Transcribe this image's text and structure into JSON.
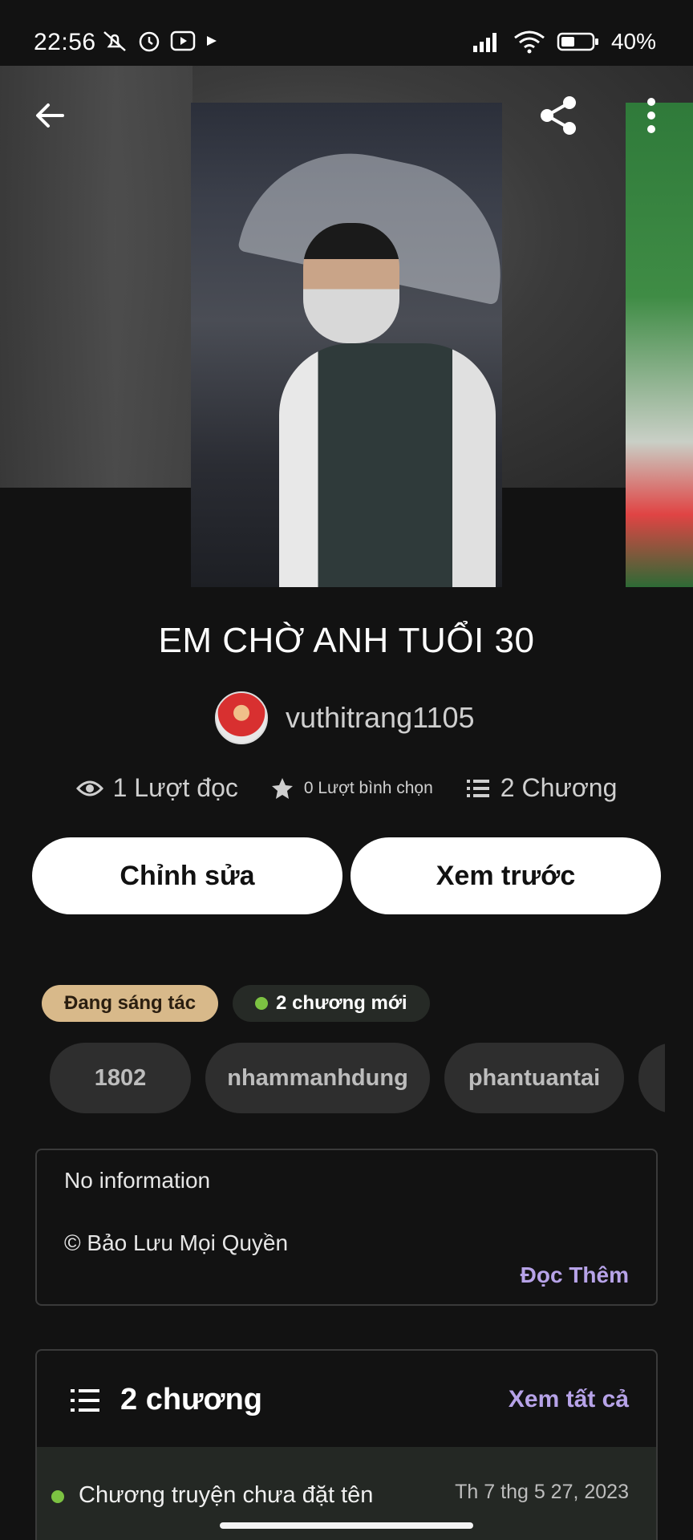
{
  "status_bar": {
    "time": "22:56",
    "battery_text": "40%",
    "icons_left": [
      "mute-icon",
      "alarm-icon",
      "youtube-icon",
      "play-icon"
    ],
    "icons_right": [
      "signal-icon",
      "wifi-icon",
      "battery-icon"
    ]
  },
  "header": {
    "back_icon": "arrow-left-icon",
    "share_icon": "share-icon",
    "more_icon": "more-vertical-icon"
  },
  "story": {
    "title": "EM CHỜ ANH TUỔI 30",
    "author": "vuthitrang1105"
  },
  "stats": {
    "reads": "1 Lượt đọc",
    "votes": "0 Lượt bình chọn",
    "chapters": "2 Chương"
  },
  "actions": {
    "edit_label": "Chỉnh sửa",
    "preview_label": "Xem trước"
  },
  "badges": {
    "status": "Đang sáng tác",
    "new_chapters": "2 chương mới"
  },
  "tags": [
    "1802",
    "nhammanhdung",
    "phantuantai",
    ""
  ],
  "description": {
    "line1": "No information",
    "line2": "© Bảo Lưu Mọi Quyền",
    "read_more": "Đọc Thêm"
  },
  "chapter_list": {
    "count_label": "2 chương",
    "see_all": "Xem tất cả",
    "items": [
      {
        "name": "Chương truyện chưa đặt tên",
        "date": "Th 7 thg 5 27, 2023"
      }
    ]
  },
  "colors": {
    "background": "#121212",
    "accent_purple": "#b7a3e8",
    "status_badge": "#d8b98a",
    "new_dot": "#7cc242"
  }
}
